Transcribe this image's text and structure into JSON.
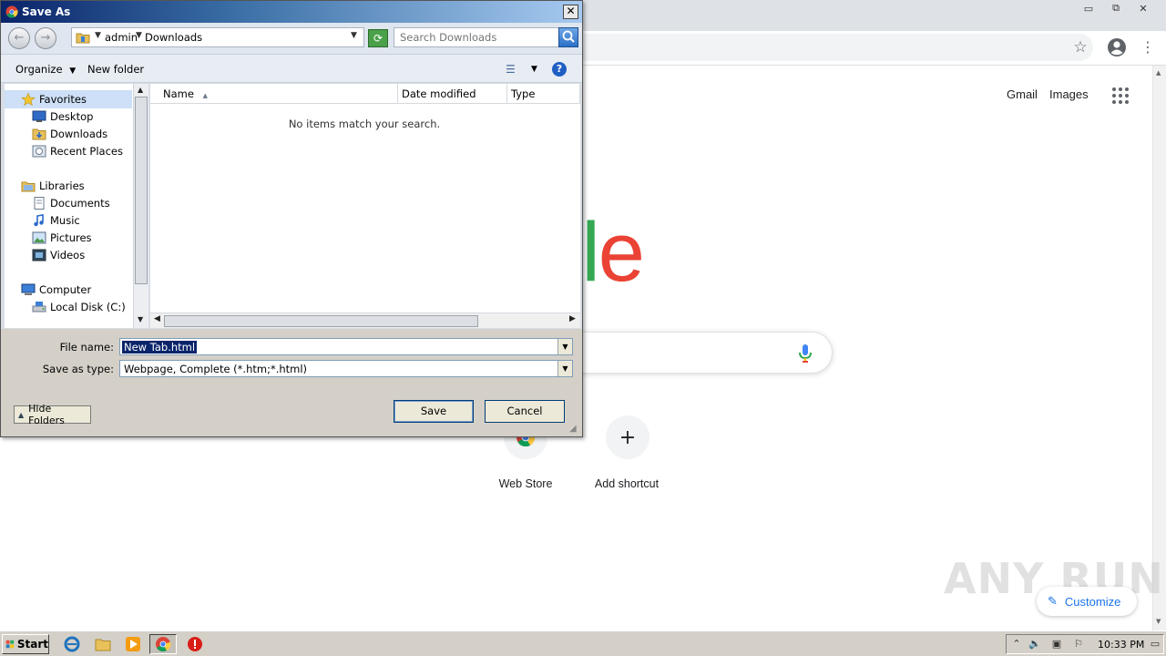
{
  "chrome": {
    "header_links": {
      "gmail": "Gmail",
      "images": "Images"
    },
    "logo_text": "ogle",
    "shortcuts": [
      {
        "label": "Web Store",
        "icon": "chrome-webstore-icon"
      },
      {
        "label": "Add shortcut",
        "icon": "plus-icon",
        "symbol": "+"
      }
    ],
    "customize_label": "Customize",
    "window_controls": {
      "minimize": "▭",
      "restore": "⧉",
      "close": "✕"
    },
    "watermark": "ANY RUN"
  },
  "dialog": {
    "title": "Save As",
    "close_symbol": "✕",
    "breadcrumb": [
      "admin",
      "Downloads"
    ],
    "search_placeholder": "Search Downloads",
    "toolbar": {
      "organize": "Organize",
      "new_folder": "New folder"
    },
    "nav": {
      "favorites": "Favorites",
      "favorites_items": [
        "Desktop",
        "Downloads",
        "Recent Places"
      ],
      "libraries": "Libraries",
      "libraries_items": [
        "Documents",
        "Music",
        "Pictures",
        "Videos"
      ],
      "computer": "Computer",
      "computer_items": [
        "Local Disk (C:)"
      ]
    },
    "columns": {
      "name": "Name",
      "date_modified": "Date modified",
      "type": "Type"
    },
    "empty_message": "No items match your search.",
    "file_name_label": "File name:",
    "file_name_value": "New Tab.html",
    "save_type_label": "Save as type:",
    "save_type_value": "Webpage, Complete (*.htm;*.html)",
    "hide_folders": "Hide Folders",
    "save_button": "Save",
    "cancel_button": "Cancel"
  },
  "taskbar": {
    "start_label": "Start",
    "clock": "10:33 PM"
  },
  "colors": {
    "google_blue": "#4285f4",
    "google_red": "#ea4335",
    "google_yellow": "#fbbc05",
    "google_green": "#34a853",
    "titlebar": "#0a246a",
    "selection": "#0a246a"
  }
}
